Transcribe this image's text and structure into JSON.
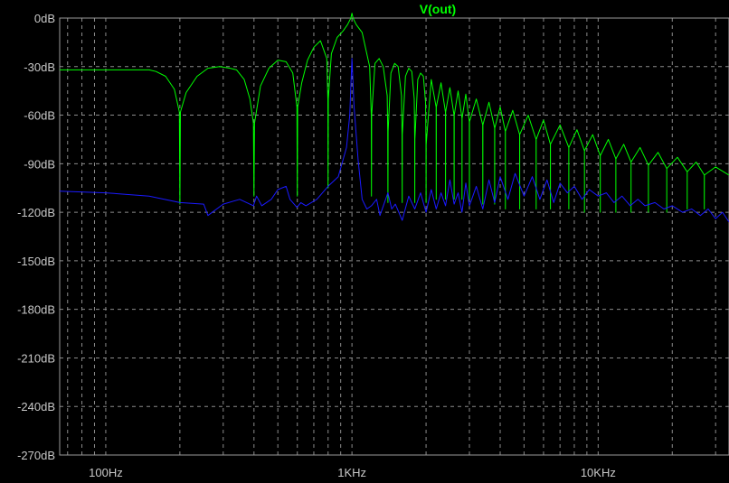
{
  "chart_data": {
    "type": "line",
    "title": "V(out)",
    "xscale": "log",
    "xlim": [
      65,
      34000
    ],
    "ylim": [
      -270,
      0
    ],
    "grid": true,
    "y_ticks": [
      {
        "value": 0,
        "label": "0dB"
      },
      {
        "value": -30,
        "label": "-30dB"
      },
      {
        "value": -60,
        "label": "-60dB"
      },
      {
        "value": -90,
        "label": "-90dB"
      },
      {
        "value": -120,
        "label": "-120dB"
      },
      {
        "value": -150,
        "label": "-150dB"
      },
      {
        "value": -180,
        "label": "-180dB"
      },
      {
        "value": -210,
        "label": "-210dB"
      },
      {
        "value": -240,
        "label": "-240dB"
      },
      {
        "value": -270,
        "label": "-270dB"
      }
    ],
    "x_ticks": [
      {
        "value": 100,
        "label": "100Hz"
      },
      {
        "value": 1000,
        "label": "1KHz"
      },
      {
        "value": 10000,
        "label": "10KHz"
      }
    ],
    "colors": {
      "background": "#000000",
      "grid": "#8c8c8c",
      "frame": "#9a9a9a",
      "title": "#00ff00",
      "text": "#c8c8c8"
    },
    "series": [
      {
        "name": "V(out)",
        "color": "#00ff00",
        "x": [
          65,
          150,
          160,
          175,
          190,
          199,
          200,
          201,
          212,
          235,
          260,
          290,
          320,
          340,
          365,
          385,
          398,
          400,
          402,
          425,
          460,
          500,
          540,
          575,
          598,
          600,
          602,
          625,
          660,
          700,
          745,
          790,
          798,
          800,
          802,
          825,
          870,
          920,
          960,
          990,
          1000,
          1010,
          1040,
          1100,
          1180,
          1198,
          1200,
          1202,
          1240,
          1290,
          1340,
          1390,
          1398,
          1400,
          1402,
          1440,
          1490,
          1540,
          1590,
          1598,
          1600,
          1602,
          1650,
          1700,
          1750,
          1790,
          1798,
          1800,
          1802,
          1850,
          1900,
          1950,
          1990,
          1998,
          2000,
          2002,
          2100,
          2198,
          2200,
          2202,
          2300,
          2398,
          2400,
          2402,
          2500,
          2598,
          2600,
          2602,
          2700,
          2798,
          2800,
          2802,
          2900,
          2998,
          3000,
          3002,
          3200,
          3398,
          3400,
          3402,
          3600,
          3798,
          3800,
          3802,
          4000,
          4198,
          4200,
          4202,
          4500,
          4798,
          4800,
          4802,
          5200,
          5598,
          5600,
          5602,
          6000,
          6398,
          6400,
          6402,
          7000,
          7598,
          7600,
          7602,
          8200,
          8798,
          8800,
          8802,
          9500,
          10198,
          10200,
          10202,
          11000,
          11798,
          11800,
          11802,
          12700,
          13598,
          13600,
          13602,
          14800,
          15998,
          16000,
          16002,
          17500,
          18998,
          19000,
          19002,
          21000,
          22998,
          23000,
          23002,
          25000,
          26998,
          27000,
          27002,
          30000,
          34000
        ],
        "y": [
          -32,
          -32,
          -33,
          -36,
          -44,
          -58,
          -115,
          -58,
          -46,
          -36,
          -31,
          -30,
          -31,
          -32,
          -38,
          -50,
          -65,
          -110,
          -65,
          -42,
          -31,
          -26,
          -27,
          -34,
          -55,
          -110,
          -55,
          -40,
          -26,
          -18,
          -14,
          -25,
          -50,
          -105,
          -50,
          -22,
          -12,
          -8,
          -4,
          0,
          3,
          0,
          -4,
          -9,
          -30,
          -60,
          -110,
          -60,
          -28,
          -25,
          -30,
          -48,
          -70,
          -114,
          -70,
          -34,
          -28,
          -30,
          -48,
          -72,
          -114,
          -72,
          -36,
          -31,
          -33,
          -50,
          -75,
          -114,
          -75,
          -38,
          -34,
          -36,
          -52,
          -78,
          -114,
          -78,
          -38,
          -55,
          -112,
          -55,
          -40,
          -58,
          -112,
          -58,
          -43,
          -60,
          -112,
          -60,
          -45,
          -62,
          -112,
          -62,
          -47,
          -64,
          -112,
          -64,
          -50,
          -66,
          -115,
          -66,
          -52,
          -68,
          -115,
          -68,
          -55,
          -70,
          -118,
          -70,
          -57,
          -72,
          -118,
          -72,
          -60,
          -75,
          -118,
          -75,
          -63,
          -78,
          -118,
          -78,
          -66,
          -80,
          -118,
          -80,
          -69,
          -82,
          -120,
          -82,
          -72,
          -85,
          -120,
          -85,
          -75,
          -87,
          -120,
          -87,
          -78,
          -89,
          -120,
          -89,
          -80,
          -91,
          -120,
          -91,
          -83,
          -93,
          -120,
          -93,
          -86,
          -95,
          -118,
          -95,
          -89,
          -97,
          -118,
          -97,
          -92,
          -97
        ]
      },
      {
        "name": "",
        "color": "#1a1aff",
        "x": [
          65,
          100,
          150,
          200,
          250,
          260,
          300,
          350,
          398,
          410,
          430,
          470,
          500,
          540,
          560,
          598,
          620,
          650,
          720,
          800,
          880,
          950,
          980,
          1000,
          1020,
          1060,
          1100,
          1150,
          1200,
          1260,
          1300,
          1400,
          1450,
          1500,
          1600,
          1700,
          1800,
          1900,
          2000,
          2100,
          2200,
          2300,
          2400,
          2500,
          2600,
          2700,
          2800,
          2900,
          3000,
          3200,
          3400,
          3600,
          3800,
          4000,
          4300,
          4600,
          5000,
          5400,
          5800,
          6200,
          6600,
          7000,
          7500,
          8000,
          8600,
          9200,
          10000,
          10800,
          11600,
          12500,
          13500,
          14500,
          15500,
          17000,
          18500,
          20000,
          22000,
          24000,
          26000,
          28000,
          30000,
          32000,
          34000
        ],
        "y": [
          -107,
          -108,
          -110,
          -114,
          -115,
          -122,
          -115,
          -112,
          -116,
          -110,
          -116,
          -112,
          -106,
          -104,
          -112,
          -117,
          -114,
          -116,
          -112,
          -104,
          -98,
          -80,
          -60,
          -25,
          -55,
          -88,
          -112,
          -118,
          -116,
          -112,
          -122,
          -108,
          -118,
          -115,
          -125,
          -110,
          -118,
          -108,
          -120,
          -106,
          -118,
          -108,
          -116,
          -100,
          -115,
          -108,
          -120,
          -102,
          -116,
          -104,
          -118,
          -100,
          -114,
          -98,
          -112,
          -96,
          -110,
          -98,
          -112,
          -100,
          -114,
          -102,
          -108,
          -104,
          -112,
          -106,
          -110,
          -108,
          -114,
          -110,
          -116,
          -112,
          -116,
          -114,
          -118,
          -116,
          -120,
          -118,
          -122,
          -118,
          -124,
          -120,
          -126
        ]
      }
    ]
  }
}
